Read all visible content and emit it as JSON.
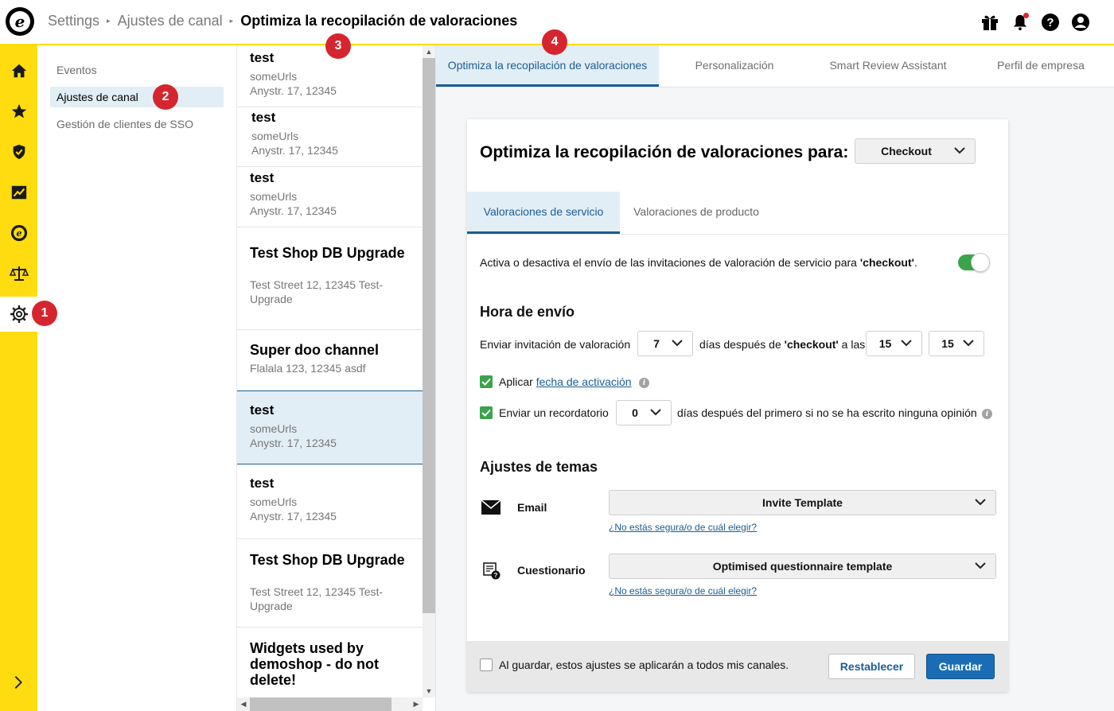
{
  "header": {
    "breadcrumbs": [
      "Settings",
      "Ajustes de canal"
    ],
    "current": "Optimiza la recopilación de valoraciones",
    "icons": [
      "gift-icon",
      "bell-icon",
      "help-icon",
      "account-icon"
    ]
  },
  "rail": {
    "items": [
      "home-icon",
      "star-icon",
      "shield-check-icon",
      "chart-icon",
      "trusted-logo-icon",
      "scales-icon",
      "gear-icon"
    ],
    "active": "gear-icon",
    "expand_icon": "chevron-right-icon"
  },
  "subnav": {
    "items": [
      {
        "label": "Eventos",
        "active": false
      },
      {
        "label": "Ajustes de canal",
        "active": true
      },
      {
        "label": "Gestión de clientes de SSO",
        "active": false
      }
    ]
  },
  "channels": [
    {
      "title": "test",
      "lines": [
        "someUrls",
        "Anystr. 17, 12345"
      ]
    },
    {
      "title": "test",
      "lines": [
        "someUrls",
        "Anystr. 17, 12345"
      ]
    },
    {
      "title": "test",
      "lines": [
        "someUrls",
        "Anystr. 17, 12345"
      ]
    },
    {
      "title": "Test Shop DB Upgrade",
      "lines": [
        "Test Street 12, 12345 Test-",
        "Upgrade"
      ]
    },
    {
      "title": "Super doo channel",
      "lines": [
        "Flalala 123, 12345 asdf"
      ]
    },
    {
      "title": "test",
      "lines": [
        "someUrls",
        "Anystr. 17, 12345"
      ],
      "active": true
    },
    {
      "title": "test",
      "lines": [
        "someUrls",
        "Anystr. 17, 12345"
      ]
    },
    {
      "title": "Test Shop DB Upgrade",
      "lines": [
        "Test Street 12, 12345 Test-",
        "Upgrade"
      ]
    },
    {
      "title": "Widgets used by demoshop - do not delete!",
      "lines": []
    }
  ],
  "tabs": [
    {
      "label": "Optimiza la recopilación de valoraciones",
      "active": true
    },
    {
      "label": "Personalización",
      "active": false
    },
    {
      "label": "Smart Review Assistant",
      "active": false
    },
    {
      "label": "Perfil de empresa",
      "active": false
    }
  ],
  "panel": {
    "title": "Optimiza la recopilación de valoraciones para:",
    "channel_select": "Checkout",
    "subtabs": [
      {
        "label": "Valoraciones de servicio",
        "active": true
      },
      {
        "label": "Valoraciones de producto",
        "active": false
      }
    ],
    "toggle_text_pre": "Activa o desactiva el envío de las invitaciones de valoración de servicio para ",
    "toggle_text_bold": "'checkout'",
    "toggle_text_post": ".",
    "toggle_on": true,
    "send_time_heading": "Hora de envío",
    "send_label": "Enviar invitación de valoración",
    "days_value": "7",
    "days_after_pre": "días después de ",
    "days_after_bold": "'checkout'",
    "days_after_post": " a las",
    "hour_value": "15",
    "minute_value": "15",
    "apply_label": "Aplicar",
    "apply_link": "fecha de activación",
    "apply_checked": true,
    "reminder_label": "Enviar un recordatorio",
    "reminder_value": "0",
    "reminder_after": "días después del primero si no se ha escrito ninguna opinión",
    "reminder_checked": true,
    "themes_heading": "Ajustes de temas",
    "email_label": "Email",
    "email_template": "Invite Template",
    "email_help": "¿No estás segura/o de cuál elegir?",
    "questionnaire_label": "Cuestionario",
    "questionnaire_template": "Optimised questionnaire template",
    "questionnaire_help": "¿No estás segura/o de cuál elegir?",
    "apply_all_label": "Al guardar, estos ajustes se aplicarán a todos mis canales.",
    "apply_all_checked": false,
    "reset_button": "Restablecer",
    "save_button": "Guardar"
  },
  "badges": [
    "1",
    "2",
    "3",
    "4"
  ],
  "colors": {
    "brand_yellow": "#ffdc0f",
    "accent_blue": "#1a5d94",
    "active_bg": "#e2eef6",
    "toggle_green": "#3aa44a",
    "badge_red": "#d5262f"
  }
}
